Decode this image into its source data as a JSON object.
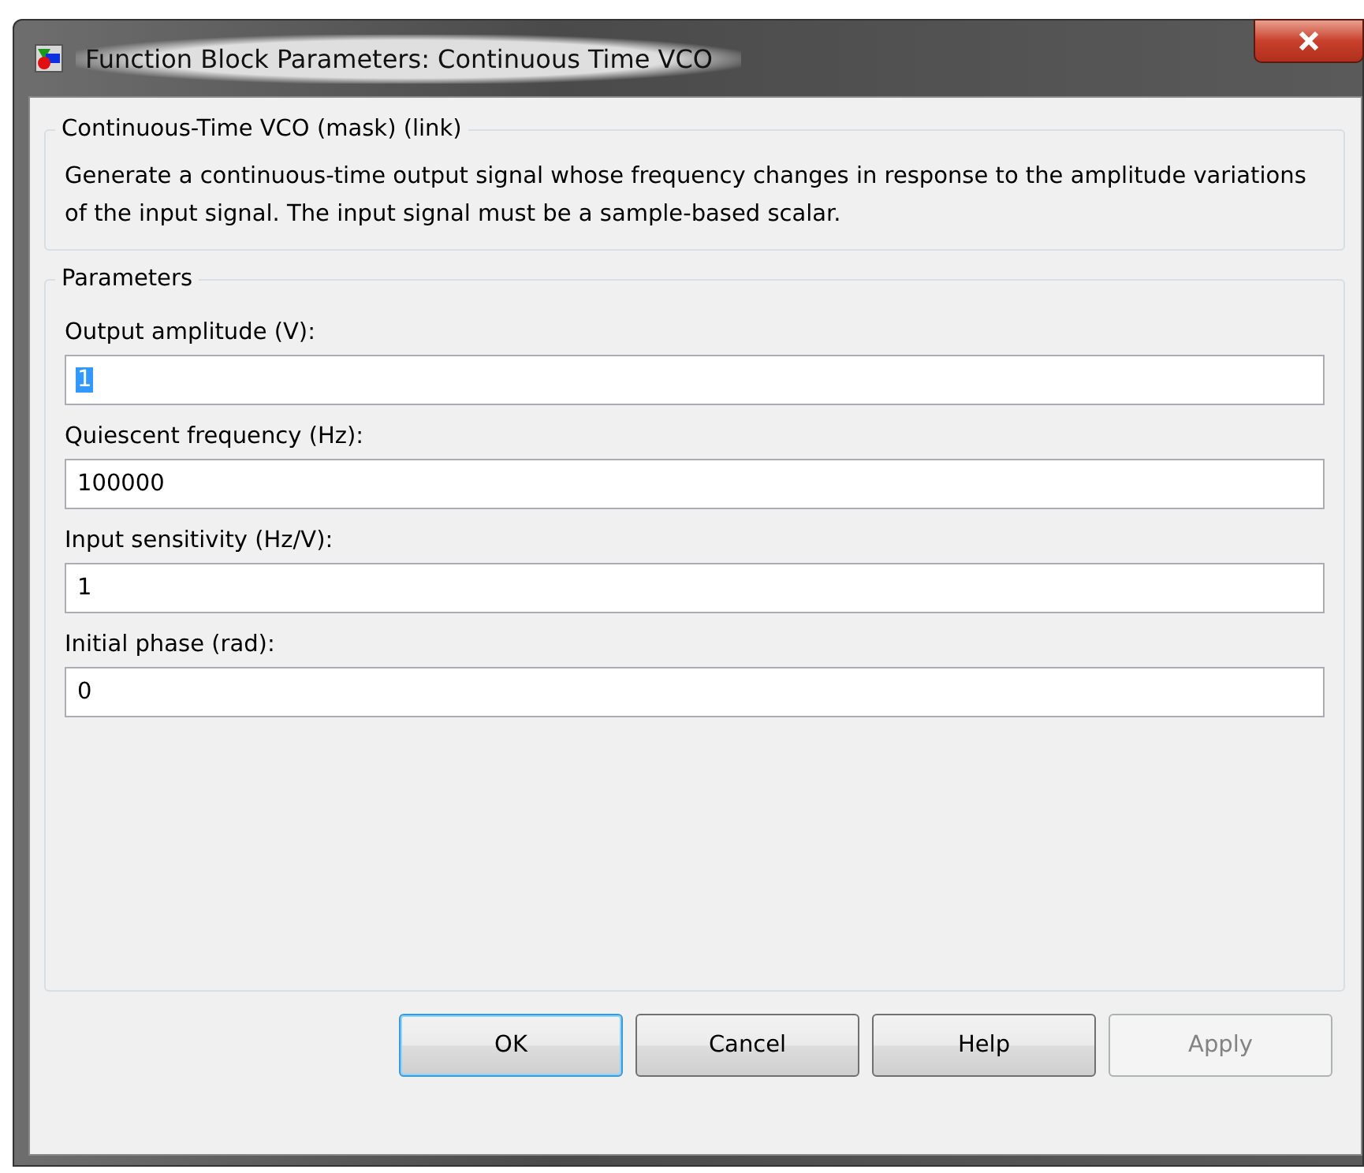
{
  "window": {
    "title": "Function Block Parameters: Continuous Time VCO"
  },
  "description": {
    "title": "Continuous-Time VCO (mask) (link)",
    "text": "Generate a continuous-time output signal whose frequency changes in response to the amplitude variations of the input signal. The input signal must be a sample-based scalar."
  },
  "parameters": {
    "title": "Parameters",
    "fields": [
      {
        "label": "Output amplitude (V):",
        "value": "1",
        "selected": true
      },
      {
        "label": "Quiescent frequency (Hz):",
        "value": "100000",
        "selected": false
      },
      {
        "label": "Input sensitivity (Hz/V):",
        "value": "1",
        "selected": false
      },
      {
        "label": "Initial phase (rad):",
        "value": "0",
        "selected": false
      }
    ]
  },
  "buttons": [
    {
      "label": "OK",
      "default": true,
      "disabled": false
    },
    {
      "label": "Cancel",
      "default": false,
      "disabled": false
    },
    {
      "label": "Help",
      "default": false,
      "disabled": false
    },
    {
      "label": "Apply",
      "default": false,
      "disabled": true
    }
  ]
}
